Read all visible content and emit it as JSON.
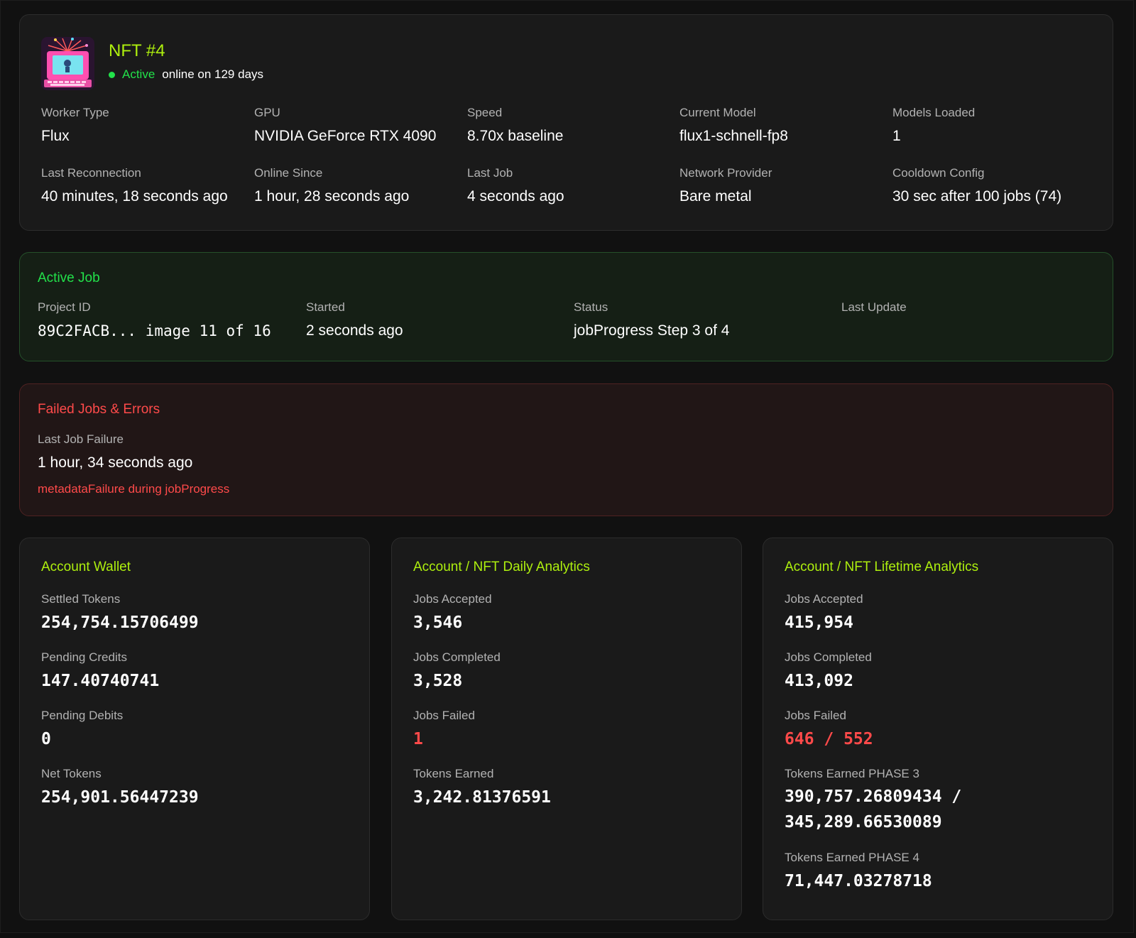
{
  "header": {
    "nft_title": "NFT #4",
    "status_label": "Active",
    "online_text": "online on 129 days",
    "fields": [
      {
        "label": "Worker Type",
        "value": "Flux"
      },
      {
        "label": "GPU",
        "value": "NVIDIA GeForce RTX 4090"
      },
      {
        "label": "Speed",
        "value": "8.70x baseline"
      },
      {
        "label": "Current Model",
        "value": "flux1-schnell-fp8"
      },
      {
        "label": "Models Loaded",
        "value": "1"
      },
      {
        "label": "Last Reconnection",
        "value": "40 minutes, 18 seconds ago"
      },
      {
        "label": "Online Since",
        "value": "1 hour, 28 seconds ago"
      },
      {
        "label": "Last Job",
        "value": "4 seconds ago"
      },
      {
        "label": "Network Provider",
        "value": "Bare metal"
      },
      {
        "label": "Cooldown Config",
        "value": "30 sec after 100 jobs (74)"
      }
    ]
  },
  "active_job": {
    "title": "Active Job",
    "project_id_label": "Project ID",
    "project_id_value": "89C2FACB... image 11 of 16",
    "started_label": "Started",
    "started_value": "2 seconds ago",
    "status_label": "Status",
    "status_value": "jobProgress Step 3 of 4",
    "last_update_label": "Last Update"
  },
  "failed_jobs": {
    "title": "Failed Jobs & Errors",
    "last_failure_label": "Last Job Failure",
    "last_failure_value": "1 hour, 34 seconds ago",
    "error_message": "metadataFailure during jobProgress"
  },
  "wallet": {
    "title": "Account Wallet",
    "items": [
      {
        "label": "Settled Tokens",
        "value": "254,754.15706499"
      },
      {
        "label": "Pending Credits",
        "value": "147.40740741"
      },
      {
        "label": "Pending Debits",
        "value": "0"
      },
      {
        "label": "Net Tokens",
        "value": "254,901.56447239"
      }
    ]
  },
  "daily": {
    "title": "Account / NFT Daily Analytics",
    "items": [
      {
        "label": "Jobs Accepted",
        "value": "3,546"
      },
      {
        "label": "Jobs Completed",
        "value": "3,528"
      },
      {
        "label": "Jobs Failed",
        "value": "1"
      },
      {
        "label": "Tokens Earned",
        "value": "3,242.81376591"
      }
    ]
  },
  "lifetime": {
    "title": "Account / NFT Lifetime Analytics",
    "items": [
      {
        "label": "Jobs Accepted",
        "value": "415,954"
      },
      {
        "label": "Jobs Completed",
        "value": "413,092"
      },
      {
        "label": "Jobs Failed",
        "value": "646 / 552"
      },
      {
        "label": "Tokens Earned PHASE 3",
        "value": "390,757.26809434 / 345,289.66530089"
      },
      {
        "label": "Tokens Earned PHASE 4",
        "value": "71,447.03278718"
      }
    ]
  },
  "colors": {
    "accent_lime": "#aef00e",
    "active_green": "#22e14a",
    "error_red": "#ff4a4a",
    "card_bg": "#1a1a1a"
  }
}
